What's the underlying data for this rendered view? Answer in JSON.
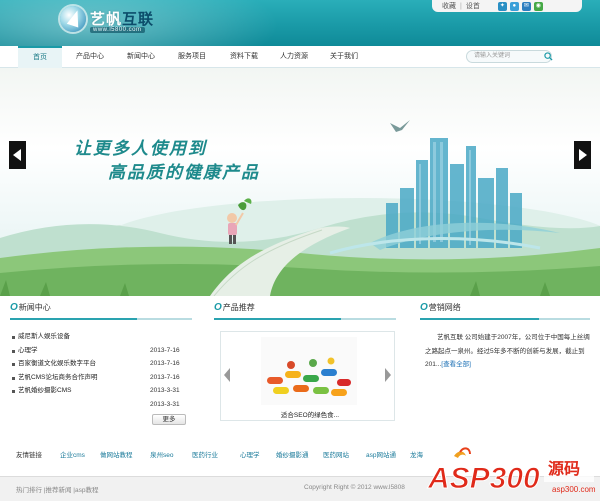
{
  "header": {
    "brand_en": "艺帆",
    "brand_cn": "互联",
    "url": "www.l5800.com",
    "topbar": {
      "favorite": "收藏",
      "settings": "设首"
    },
    "colors": {
      "primary": "#1a9aa7",
      "accent": "#1e8a8c"
    }
  },
  "nav": {
    "items": [
      "首页",
      "产品中心",
      "新闻中心",
      "服务项目",
      "资料下载",
      "人力资源",
      "关于我们"
    ],
    "search_placeholder": "请输入关键词"
  },
  "banner": {
    "slogan_line1": "让更多人使用到",
    "slogan_line2": "高品质的健康产品"
  },
  "sections": {
    "news_title": "新闻中心",
    "products_title": "产品推荐",
    "marketing_title": "营销网络"
  },
  "news": {
    "items": [
      {
        "title": "威尼斯人娱乐设备",
        "date": ""
      },
      {
        "title": "心理学",
        "date": "2013-7-16"
      },
      {
        "title": "百家衡道文化娱乐数字平台",
        "date": "2013-7-16"
      },
      {
        "title": "艺帆CMS论坛商务合作声明",
        "date": "2013-7-16"
      },
      {
        "title": "艺帆婚纱摄影CMS",
        "date": "2013-3-31"
      },
      {
        "title": "",
        "date": "2013-3-31"
      }
    ],
    "more": "更多"
  },
  "product": {
    "caption": "适合SEO的绿色食..."
  },
  "marketing": {
    "text": "艺帆互联 公司始建于2007年，公司位于中国每上丝绸之路起点一泉州。经过5年多不断的创新与发展，截止到201...",
    "link": "[查看全部]"
  },
  "friend_links": {
    "label": "友情链接",
    "items": [
      "企业cms",
      "做网站教程",
      "泉州seo",
      "医药行业",
      "心理学",
      "婚纱摄影通",
      "医药网站",
      "asp网站通",
      "龙海"
    ]
  },
  "footer": {
    "left": "热门排行 |推荐新闻 |asp教程",
    "copyright": "Copyright Right © 2012 www.l5808"
  },
  "watermark": {
    "brand": "ASP300",
    "cn": "源码",
    "url": "asp300.com"
  }
}
